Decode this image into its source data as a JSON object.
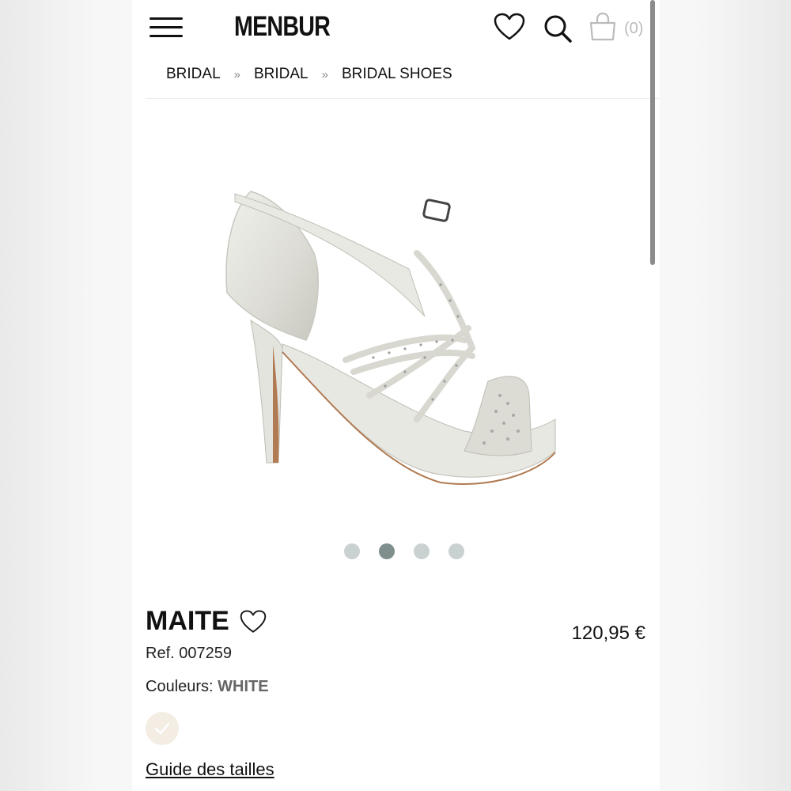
{
  "header": {
    "brand": "MENBUR",
    "cart_count": "(0)"
  },
  "breadcrumb": {
    "items": [
      "BRIDAL",
      "BRIDAL",
      "BRIDAL SHOES"
    ],
    "separator": "»"
  },
  "gallery": {
    "image_count": 4,
    "active_index": 1
  },
  "product": {
    "name": "MAITE",
    "price": "120,95 €",
    "ref": "Ref. 007259",
    "colors_label": "Couleurs:",
    "color_value": "WHITE",
    "size_guide": "Guide des tailles"
  },
  "icons": {
    "menu": "hamburger-icon",
    "wishlist": "heart-icon",
    "search": "search-icon",
    "cart": "shopping-bag-icon",
    "swatch_check": "check-icon"
  },
  "colors": {
    "dot_active": "#7f8f8d",
    "dot_inactive": "#c9d1d1",
    "swatch_white": "#f3ede4"
  }
}
